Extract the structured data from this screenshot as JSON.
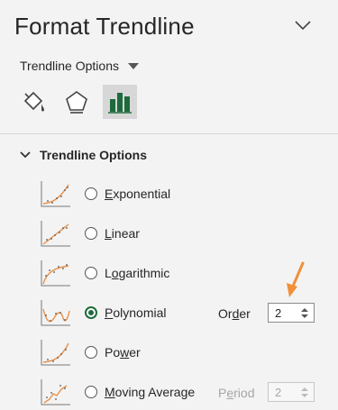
{
  "panel": {
    "title": "Format Trendline",
    "dropdown_label": "Trendline Options",
    "tabs": [
      {
        "name": "fill-line",
        "icon": "paint-bucket-icon"
      },
      {
        "name": "effects",
        "icon": "pentagon-icon"
      },
      {
        "name": "trendline-options",
        "icon": "bar-chart-icon",
        "active": true
      }
    ]
  },
  "section": {
    "title": "Trendline Options"
  },
  "options": [
    {
      "label": "Exponential",
      "checked": false
    },
    {
      "label": "Linear",
      "checked": false
    },
    {
      "label": "Logarithmic",
      "checked": false
    },
    {
      "label": "Polynomial",
      "checked": true
    },
    {
      "label": "Power",
      "checked": false
    },
    {
      "label": "Moving Average",
      "checked": false
    }
  ],
  "order": {
    "label": "Order",
    "value": "2"
  },
  "period": {
    "label": "Period",
    "value": "2",
    "disabled": true
  },
  "colors": {
    "accent": "#1e6a3c",
    "annotation_arrow": "#f0903a",
    "trend_line": "#e8914b"
  }
}
